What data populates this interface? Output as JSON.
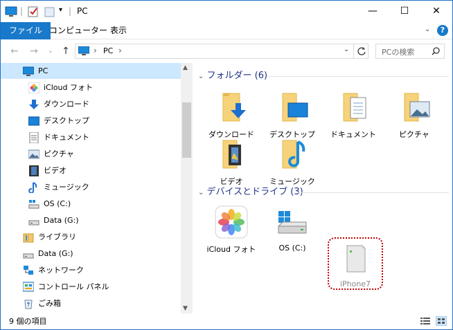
{
  "window": {
    "title": "PC"
  },
  "titlebar": {
    "minimize_glyph": "—",
    "maximize_glyph": "☐",
    "close_glyph": "✕"
  },
  "ribbon": {
    "tabs": [
      {
        "label": "ファイル"
      },
      {
        "label": "コンピューター"
      },
      {
        "label": "表示"
      }
    ],
    "expand_glyph": "⌄",
    "help_glyph": "?"
  },
  "navigation": {
    "back_glyph": "←",
    "forward_glyph": "→",
    "recent_glyph": "⌄",
    "up_glyph": "↑",
    "address_path": "PC",
    "separator": "›",
    "search_placeholder": "PCの検索"
  },
  "nav_tree": [
    {
      "label": "PC",
      "icon": "pc-icon"
    },
    {
      "label": "iCloud フォト",
      "icon": "icloud-photos-icon"
    },
    {
      "label": "ダウンロード",
      "icon": "downloads-icon"
    },
    {
      "label": "デスクトップ",
      "icon": "desktop-icon"
    },
    {
      "label": "ドキュメント",
      "icon": "documents-icon"
    },
    {
      "label": "ピクチャ",
      "icon": "pictures-icon"
    },
    {
      "label": "ビデオ",
      "icon": "videos-icon"
    },
    {
      "label": "ミュージック",
      "icon": "music-icon"
    },
    {
      "label": "OS (C:)",
      "icon": "drive-c-icon"
    },
    {
      "label": "Data (G:)",
      "icon": "drive-g-icon"
    },
    {
      "label": "ライブラリ",
      "icon": "libraries-icon"
    },
    {
      "label": "Data (G:)",
      "icon": "drive-g-icon"
    },
    {
      "label": "ネットワーク",
      "icon": "network-icon"
    },
    {
      "label": "コントロール パネル",
      "icon": "control-panel-icon"
    },
    {
      "label": "ごみ箱",
      "icon": "recycle-bin-icon"
    }
  ],
  "groups": {
    "folders": {
      "heading": "フォルダー (6)",
      "items": [
        {
          "label": "ダウンロード",
          "icon": "downloads-folder-icon"
        },
        {
          "label": "デスクトップ",
          "icon": "desktop-folder-icon"
        },
        {
          "label": "ドキュメント",
          "icon": "documents-folder-icon"
        },
        {
          "label": "ピクチャ",
          "icon": "pictures-folder-icon"
        },
        {
          "label": "ビデオ",
          "icon": "videos-folder-icon"
        },
        {
          "label": "ミュージック",
          "icon": "music-folder-icon"
        }
      ]
    },
    "devices": {
      "heading": "デバイスとドライブ (3)",
      "items": [
        {
          "label": "iCloud フォト",
          "icon": "icloud-photos-large-icon"
        },
        {
          "label": "OS (C:)",
          "icon": "os-drive-icon"
        },
        {
          "label": "iPhone7",
          "icon": "iphone-device-icon"
        }
      ]
    }
  },
  "status": {
    "item_count": "9 個の項目"
  },
  "colors": {
    "accent": "#1979ca",
    "highlight_ring": "#c00000",
    "heading": "#1e3287"
  }
}
